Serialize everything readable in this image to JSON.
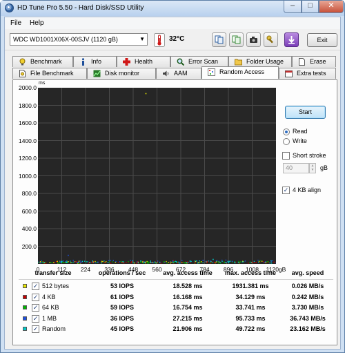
{
  "window": {
    "title": "HD Tune Pro 5.50 - Hard Disk/SSD Utility"
  },
  "menu": [
    {
      "label": "File"
    },
    {
      "label": "Help"
    }
  ],
  "toolbar": {
    "drive": "WDC    WD1001X06X-00SJV (1120 gB)",
    "temperature": "32°C",
    "exit_label": "Exit"
  },
  "tabs_row1": [
    {
      "label": "Benchmark"
    },
    {
      "label": "Info"
    },
    {
      "label": "Health"
    },
    {
      "label": "Error Scan"
    },
    {
      "label": "Folder Usage"
    },
    {
      "label": "Erase"
    }
  ],
  "tabs_row2": [
    {
      "label": "File Benchmark"
    },
    {
      "label": "Disk monitor"
    },
    {
      "label": "AAM"
    },
    {
      "label": "Random Access"
    },
    {
      "label": "Extra tests"
    }
  ],
  "chart_data": {
    "type": "scatter",
    "y_unit": "ms",
    "x_unit": "gB",
    "ylim": [
      0,
      2000
    ],
    "xlim": [
      0,
      1120
    ],
    "y_ticks": [
      "2000.0",
      "1800.0",
      "1600.0",
      "1400.0",
      "1200.0",
      "1000.0",
      "800.0",
      "600.0",
      "400.0",
      "200.0"
    ],
    "x_ticks": [
      "0",
      "112",
      "224",
      "336",
      "448",
      "560",
      "672",
      "784",
      "896",
      "1008",
      "1120gB"
    ],
    "grid": true,
    "series": [
      {
        "name": "512 bytes",
        "color": "#e8e800",
        "avg_ms": 18.528,
        "max_ms": 1931.381
      },
      {
        "name": "4 KB",
        "color": "#c80000",
        "avg_ms": 16.168,
        "max_ms": 34.129
      },
      {
        "name": "64 KB",
        "color": "#00b400",
        "avg_ms": 16.754,
        "max_ms": 33.741
      },
      {
        "name": "1 MB",
        "color": "#1e50dc",
        "avg_ms": 27.215,
        "max_ms": 95.733
      },
      {
        "name": "Random",
        "color": "#00c8c8",
        "avg_ms": 21.906,
        "max_ms": 49.722
      }
    ]
  },
  "controls": {
    "start_label": "Start",
    "read_label": "Read",
    "write_label": "Write",
    "selected_mode": "Read",
    "short_stroke_label": "Short stroke",
    "short_stroke_checked": false,
    "short_stroke_value": "40",
    "short_stroke_unit": "gB",
    "align_label": "4 KB align",
    "align_checked": true
  },
  "results": {
    "headers": [
      "transfer size",
      "operations / sec",
      "avg. access time",
      "max. access time",
      "avg. speed"
    ],
    "rows": [
      {
        "size": "512 bytes",
        "color": "#e8e800",
        "ops": "53 IOPS",
        "avg": "18.528 ms",
        "max": "1931.381 ms",
        "speed": "0.026 MB/s"
      },
      {
        "size": "4 KB",
        "color": "#c80000",
        "ops": "61 IOPS",
        "avg": "16.168 ms",
        "max": "34.129 ms",
        "speed": "0.242 MB/s"
      },
      {
        "size": "64 KB",
        "color": "#00b400",
        "ops": "59 IOPS",
        "avg": "16.754 ms",
        "max": "33.741 ms",
        "speed": "3.730 MB/s"
      },
      {
        "size": "1 MB",
        "color": "#1e50dc",
        "ops": "36 IOPS",
        "avg": "27.215 ms",
        "max": "95.733 ms",
        "speed": "36.743 MB/s"
      },
      {
        "size": "Random",
        "color": "#00c8c8",
        "ops": "45 IOPS",
        "avg": "21.906 ms",
        "max": "49.722 ms",
        "speed": "23.162 MB/s"
      }
    ]
  }
}
